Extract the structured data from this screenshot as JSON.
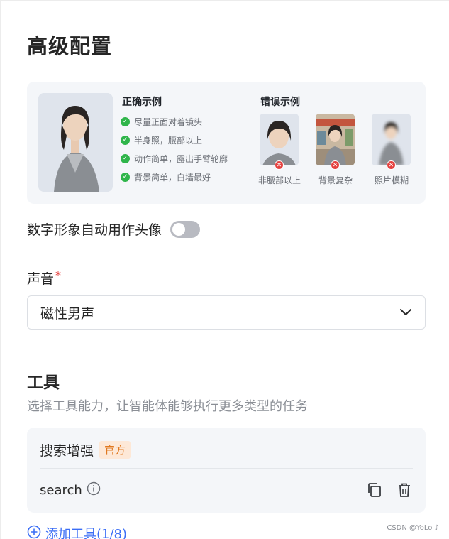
{
  "page": {
    "title": "高级配置"
  },
  "samples": {
    "correct_title": "正确示例",
    "correct_items": [
      "尽量正面对着镜头",
      "半身照，腰部以上",
      "动作简单，露出手臂轮廓",
      "背景简单，白墙最好"
    ],
    "wrong_title": "错误示例",
    "wrong_items": [
      "非腰部以上",
      "背景复杂",
      "照片模糊"
    ]
  },
  "avatar_toggle": {
    "label": "数字形象自动用作头像",
    "enabled": false
  },
  "voice": {
    "label": "声音",
    "required_mark": "*",
    "selected": "磁性男声"
  },
  "tools": {
    "title": "工具",
    "description": "选择工具能力，让智能体能够执行更多类型的任务",
    "items": [
      {
        "name": "搜索增强",
        "tag": "官方",
        "function": "search"
      }
    ],
    "add_label": "添加工具(1/8)"
  },
  "watermark": "CSDN @YoLo ♪",
  "colors": {
    "accent": "#3b6ef6",
    "success": "#2fb54a",
    "error": "#e5413f",
    "tag_text": "#e0781f",
    "tag_bg": "#fde8d7"
  }
}
